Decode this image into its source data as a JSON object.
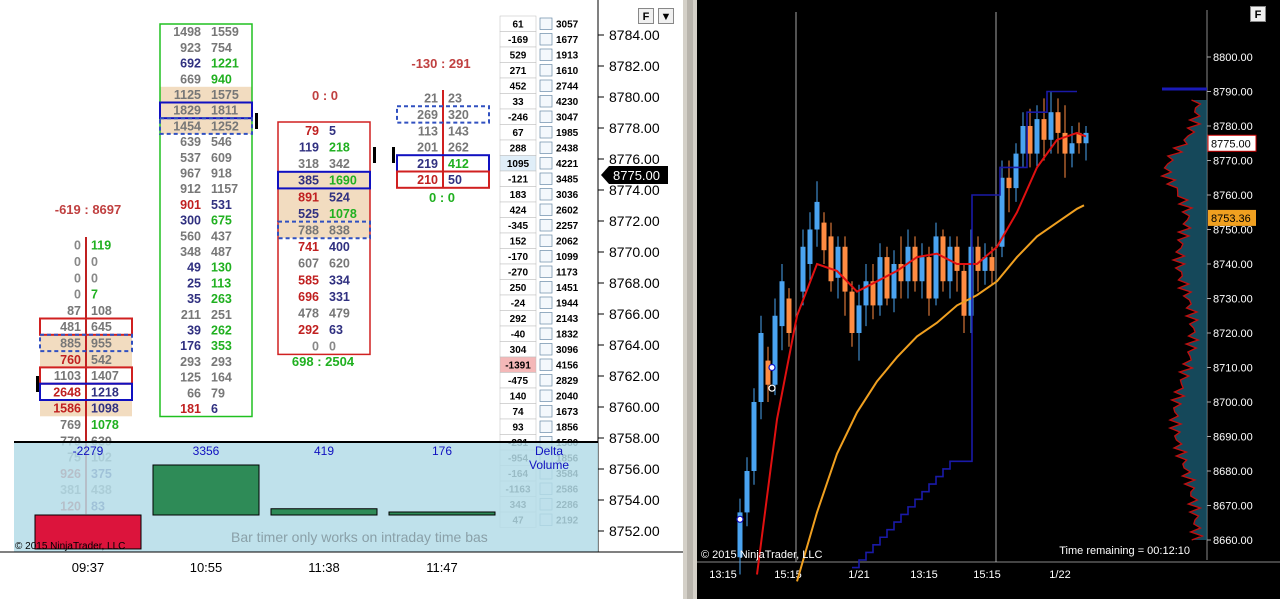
{
  "left_chart": {
    "time_labels": [
      "09:37",
      "10:55",
      "11:38",
      "11:47"
    ],
    "copyright": "© 2015 NinjaTrader, LLC",
    "bar_timer": "Bar timer only works on intraday time bas",
    "delta_label": "Delta",
    "volume_label": "Volume",
    "current_price": "8775.00",
    "header_button": "F",
    "volume_values": [
      "-2279",
      "3356",
      "419",
      "176"
    ],
    "price_axis": [
      "8784.00",
      "8782.00",
      "8780.00",
      "8778.00",
      "8776.00",
      "8774.00",
      "8772.00",
      "8770.00",
      "8768.00",
      "8766.00",
      "8764.00",
      "8762.00",
      "8760.00",
      "8758.00",
      "8756.00",
      "8754.00",
      "8752.00"
    ],
    "bar_headers": [
      {
        "text": "-619 : 8697",
        "color": "#c04040"
      },
      {
        "text": "0 : 0",
        "color": "#c04040"
      },
      {
        "text": "-130 : 291",
        "color": "#c04040"
      },
      {
        "text": "0 : 0",
        "color": "#20b020"
      },
      {
        "text": "698 : 2504",
        "color": "#20b020"
      }
    ],
    "footprint_bars": [
      {
        "name": "bar-1",
        "rows": [
          [
            "0",
            "119"
          ],
          [
            "0",
            "0"
          ],
          [
            "0",
            "0"
          ],
          [
            "0",
            "7"
          ],
          [
            "87",
            "108"
          ],
          [
            "481",
            "645"
          ],
          [
            "885",
            "955"
          ],
          [
            "760",
            "542"
          ],
          [
            "1103",
            "1407"
          ],
          [
            "2648",
            "1218"
          ],
          [
            "1586",
            "1098"
          ],
          [
            "769",
            "1078"
          ],
          [
            "779",
            "639"
          ],
          [
            "75",
            "102"
          ],
          [
            "926",
            "375"
          ],
          [
            "381",
            "438"
          ],
          [
            "120",
            "83"
          ]
        ]
      },
      {
        "name": "bar-2",
        "rows": [
          [
            "1498",
            "1559"
          ],
          [
            "923",
            "754"
          ],
          [
            "692",
            "1221"
          ],
          [
            "669",
            "940"
          ],
          [
            "1125",
            "1575"
          ],
          [
            "1829",
            "1811"
          ],
          [
            "1454",
            "1252"
          ],
          [
            "639",
            "546"
          ],
          [
            "537",
            "609"
          ],
          [
            "967",
            "918"
          ],
          [
            "912",
            "1157"
          ],
          [
            "901",
            "531"
          ],
          [
            "300",
            "675"
          ],
          [
            "560",
            "437"
          ],
          [
            "348",
            "487"
          ],
          [
            "49",
            "130"
          ],
          [
            "25",
            "113"
          ],
          [
            "35",
            "263"
          ],
          [
            "211",
            "251"
          ],
          [
            "39",
            "262"
          ],
          [
            "176",
            "353"
          ],
          [
            "293",
            "293"
          ],
          [
            "125",
            "164"
          ],
          [
            "66",
            "79"
          ],
          [
            "181",
            "6"
          ]
        ]
      },
      {
        "name": "bar-3",
        "rows": [
          [
            "79",
            "5"
          ],
          [
            "119",
            "218"
          ],
          [
            "318",
            "342"
          ],
          [
            "385",
            "1690"
          ],
          [
            "891",
            "524"
          ],
          [
            "525",
            "1078"
          ],
          [
            "788",
            "838"
          ],
          [
            "741",
            "400"
          ],
          [
            "607",
            "620"
          ],
          [
            "585",
            "334"
          ],
          [
            "696",
            "331"
          ],
          [
            "478",
            "479"
          ],
          [
            "292",
            "63"
          ],
          [
            "0",
            "0"
          ]
        ]
      },
      {
        "name": "bar-4",
        "rows": [
          [
            "21",
            "23"
          ],
          [
            "269",
            "320"
          ],
          [
            "113",
            "143"
          ],
          [
            "201",
            "262"
          ],
          [
            "219",
            "412"
          ],
          [
            "210",
            "50"
          ]
        ]
      }
    ],
    "ladder": [
      [
        "61",
        "3057"
      ],
      [
        "-169",
        "1677"
      ],
      [
        "529",
        "1913"
      ],
      [
        "271",
        "1610"
      ],
      [
        "452",
        "2744"
      ],
      [
        "33",
        "4230"
      ],
      [
        "-246",
        "3047"
      ],
      [
        "67",
        "1985"
      ],
      [
        "288",
        "2438"
      ],
      [
        "1095",
        "4221"
      ],
      [
        "-121",
        "3485"
      ],
      [
        "183",
        "3036"
      ],
      [
        "424",
        "2602"
      ],
      [
        "-345",
        "2257"
      ],
      [
        "152",
        "2062"
      ],
      [
        "-170",
        "1099"
      ],
      [
        "-270",
        "1173"
      ],
      [
        "250",
        "1451"
      ],
      [
        "-24",
        "1944"
      ],
      [
        "292",
        "2143"
      ],
      [
        "-40",
        "1832"
      ],
      [
        "304",
        "3096"
      ],
      [
        "-1391",
        "4156"
      ],
      [
        "-475",
        "2829"
      ],
      [
        "140",
        "2040"
      ],
      [
        "74",
        "1673"
      ],
      [
        "93",
        "1856"
      ],
      [
        "-231",
        "1580"
      ],
      [
        "-954",
        "1856"
      ],
      [
        "-164",
        "3584"
      ],
      [
        "-1163",
        "2586"
      ],
      [
        "343",
        "2286"
      ],
      [
        "47",
        "2192"
      ]
    ],
    "volume_bars": [
      {
        "value": -2279,
        "color": "#dc143c"
      },
      {
        "value": 3356,
        "color": "#2e8b57"
      },
      {
        "value": 419,
        "color": "#2e8b57"
      },
      {
        "value": 176,
        "color": "#2e8b57"
      }
    ]
  },
  "right_chart": {
    "header_button": "F",
    "copyright": "© 2015 NinjaTrader, LLC",
    "time_remaining": "Time remaining = 00:12:10",
    "x_labels": [
      "13:15",
      "15:15",
      "1/21",
      "13:15",
      "15:15",
      "1/22"
    ],
    "y_labels": [
      "8800.00",
      "8790.00",
      "8780.00",
      "8770.00",
      "8760.00",
      "8750.00",
      "8740.00",
      "8730.00",
      "8720.00",
      "8710.00",
      "8700.00",
      "8690.00",
      "8680.00",
      "8670.00",
      "8660.00"
    ],
    "price_tag": "8775.00",
    "ema_tag": "8753.36",
    "colors": {
      "up": "#4aa3f0",
      "down": "#ff8c42",
      "ema_fast": "#e01010",
      "ema_slow": "#f0a020",
      "step": "#1a1aa8",
      "profile": "#c01010",
      "profile_fill": "#1e6680"
    }
  }
}
